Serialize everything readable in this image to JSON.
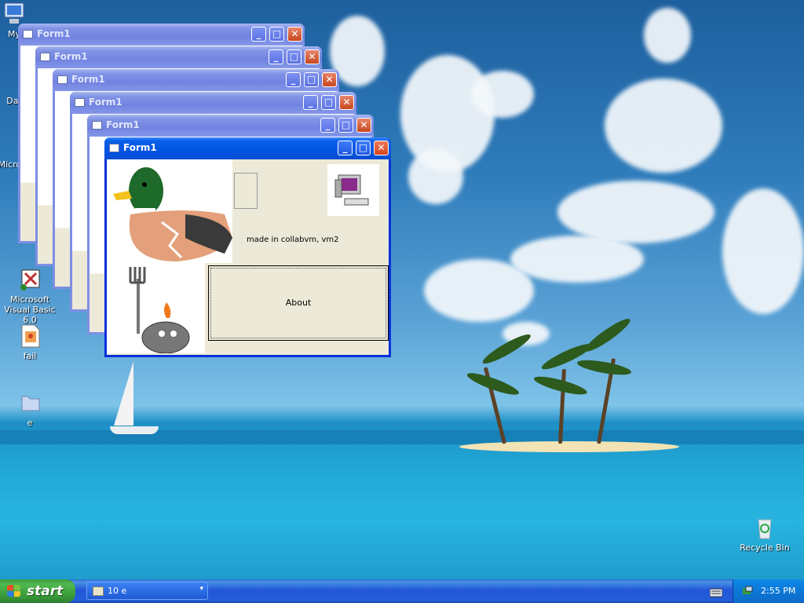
{
  "desktop_icons": [
    {
      "label": "My",
      "icon": "my-computer-icon"
    },
    {
      "label": "Dat",
      "icon": "data-icon"
    },
    {
      "label": "Micro C",
      "icon": "microsoft-icon"
    },
    {
      "label": "Microsoft Visual Basic 6.0",
      "icon": "visual-basic-icon"
    },
    {
      "label": "fail",
      "icon": "image-file-icon"
    },
    {
      "label": "e",
      "icon": "folder-icon"
    },
    {
      "label": "Recycle Bin",
      "icon": "recycle-bin-icon"
    }
  ],
  "windows": [
    {
      "title": "Form1"
    },
    {
      "title": "Form1"
    },
    {
      "title": "Form1"
    },
    {
      "title": "Form1"
    },
    {
      "title": "Form1"
    },
    {
      "title": "Form1"
    }
  ],
  "form": {
    "caption_label": "made in collabvm, vm2",
    "about_button": "About",
    "title_buttons": {
      "minimize": "_",
      "maximize": "□",
      "close": "✕"
    }
  },
  "taskbar": {
    "start_label": "start",
    "task_button_label": "10 e",
    "clock": "2:55 PM"
  },
  "colors": {
    "active_titlebar": "#0054e3",
    "inactive_titlebar": "#7183e0",
    "window_face": "#ece9d8",
    "start_green": "#3a9a3a"
  }
}
